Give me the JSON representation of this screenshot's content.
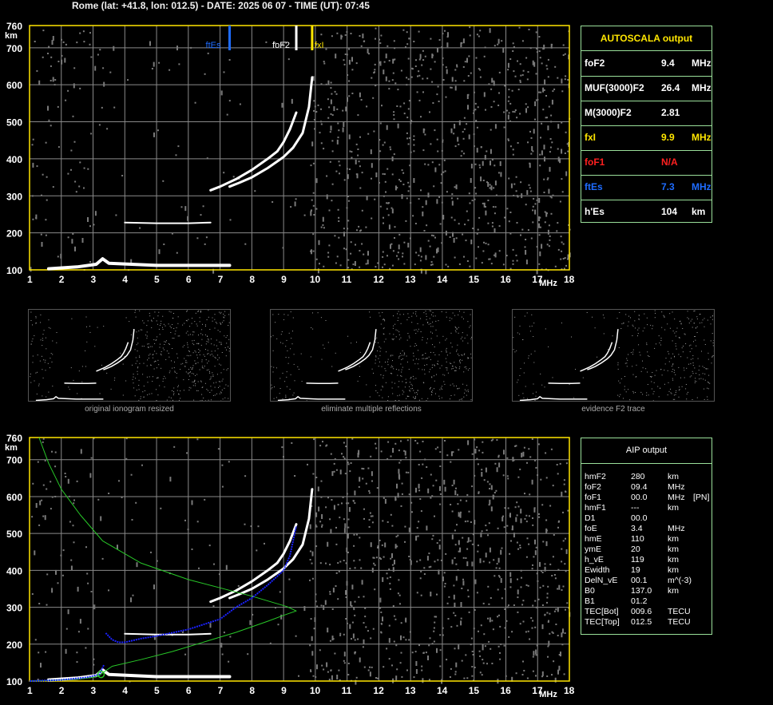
{
  "header": {
    "title": "Rome (lat: +41.8, lon: 012.5) - DATE: 2025 06 07 - TIME (UT): 07:45"
  },
  "colors": {
    "frame": "#ffe600",
    "grid": "#8a8a8a",
    "box": "#9adf9a",
    "blue": "#1e6cff",
    "red": "#ff2020",
    "green": "#28c828",
    "trace": "#1a22ff"
  },
  "autoscala": {
    "title": "AUTOSCALA output",
    "rows": [
      {
        "key": "foF2",
        "value": "9.4",
        "unit": "MHz",
        "color": "#ffffff"
      },
      {
        "key": "MUF(3000)F2",
        "value": "26.4",
        "unit": "MHz",
        "color": "#ffffff"
      },
      {
        "key": "M(3000)F2",
        "value": "2.81",
        "unit": "",
        "color": "#ffffff"
      },
      {
        "key": "fxI",
        "value": "9.9",
        "unit": "MHz",
        "color": "#ffe600"
      },
      {
        "key": "foF1",
        "value": "N/A",
        "unit": "",
        "color": "#ff2020"
      },
      {
        "key": "ftEs",
        "value": "7.3",
        "unit": "MHz",
        "color": "#1e6cff"
      },
      {
        "key": "h'Es",
        "value": "104",
        "unit": "km",
        "color": "#ffffff"
      }
    ]
  },
  "aip": {
    "title": "AIP output",
    "rows": [
      {
        "key": "hmF2",
        "value": "280",
        "unit": "km",
        "extra": ""
      },
      {
        "key": "foF2",
        "value": "09.4",
        "unit": "MHz",
        "extra": ""
      },
      {
        "key": "foF1",
        "value": "00.0",
        "unit": "MHz",
        "extra": "[PN]"
      },
      {
        "key": "hmF1",
        "value": "---",
        "unit": "km",
        "extra": ""
      },
      {
        "key": "D1",
        "value": "00.0",
        "unit": "",
        "extra": ""
      },
      {
        "key": "foE",
        "value": "3.4",
        "unit": "MHz",
        "extra": ""
      },
      {
        "key": "hmE",
        "value": "110",
        "unit": "km",
        "extra": ""
      },
      {
        "key": "ymE",
        "value": "20",
        "unit": "km",
        "extra": ""
      },
      {
        "key": "h_vE",
        "value": "119",
        "unit": "km",
        "extra": ""
      },
      {
        "key": "Ewidth",
        "value": "19",
        "unit": "km",
        "extra": ""
      },
      {
        "key": "DelN_vE",
        "value": "00.1",
        "unit": "m^(-3)",
        "extra": ""
      },
      {
        "key": "B0",
        "value": "137.0",
        "unit": "km",
        "extra": ""
      },
      {
        "key": "B1",
        "value": "01.2",
        "unit": "",
        "extra": ""
      },
      {
        "key": "TEC[Bot]",
        "value": "009.6",
        "unit": "TECU",
        "extra": ""
      },
      {
        "key": "TEC[Top]",
        "value": "012.5",
        "unit": "TECU",
        "extra": ""
      }
    ]
  },
  "thumbnails": [
    {
      "caption": "original ionogram resized"
    },
    {
      "caption": "eliminate multiple reflections"
    },
    {
      "caption": "evidence F2 trace"
    }
  ],
  "chart_data": [
    {
      "type": "scatter",
      "title": "",
      "xlabel": "MHz",
      "ylabel": "km",
      "xlim": [
        1,
        18
      ],
      "ylim": [
        100,
        760
      ],
      "xticks": [
        "1",
        "2",
        "3",
        "4",
        "5",
        "6",
        "7",
        "8",
        "9",
        "10",
        "11",
        "12",
        "13",
        "14",
        "15",
        "16",
        "17",
        "18"
      ],
      "yticks": [
        "100",
        "200",
        "300",
        "400",
        "500",
        "600",
        "700",
        "760"
      ],
      "markers": [
        {
          "label": "ftEs",
          "x": 7.3,
          "color": "#1e6cff"
        },
        {
          "label": "foF2",
          "x": 9.4,
          "color": "#ffffff"
        },
        {
          "label": "fxI",
          "x": 9.9,
          "color": "#ffe600"
        }
      ],
      "series": [
        {
          "kind": "o-trace",
          "x": [
            6.7,
            7.0,
            7.5,
            8.0,
            8.5,
            8.8,
            9.0,
            9.2,
            9.4
          ],
          "y": [
            315,
            325,
            345,
            370,
            400,
            420,
            445,
            480,
            525
          ]
        },
        {
          "kind": "x-trace",
          "x": [
            7.3,
            7.6,
            8.0,
            8.5,
            9.0,
            9.3,
            9.6,
            9.8,
            9.9
          ],
          "y": [
            325,
            335,
            350,
            375,
            405,
            430,
            470,
            540,
            620
          ]
        },
        {
          "kind": "E/Es trace",
          "x": [
            1.6,
            2.5,
            3.1,
            3.3,
            3.5,
            5.0,
            7.3
          ],
          "y": [
            103,
            108,
            115,
            130,
            118,
            112,
            112
          ]
        },
        {
          "kind": "multiple",
          "x": [
            4.0,
            5.0,
            6.0,
            6.7
          ],
          "y": [
            228,
            226,
            226,
            228
          ]
        }
      ]
    },
    {
      "type": "line",
      "title": "",
      "xlabel": "MHz",
      "ylabel": "km",
      "xlim": [
        1,
        18
      ],
      "ylim": [
        100,
        760
      ],
      "xticks": [
        "1",
        "2",
        "3",
        "4",
        "5",
        "6",
        "7",
        "8",
        "9",
        "10",
        "11",
        "12",
        "13",
        "14",
        "15",
        "16",
        "17",
        "18"
      ],
      "yticks": [
        "100",
        "200",
        "300",
        "400",
        "500",
        "600",
        "700",
        "760"
      ],
      "series": [
        {
          "name": "",
          "kind": "profile",
          "x": [
            1.0,
            2.0,
            2.6,
            3.0,
            3.2,
            3.3,
            3.6,
            4.5,
            5.5,
            6.5,
            7.5,
            8.5,
            9.0,
            9.4,
            9.1,
            8.0,
            6.0,
            4.5,
            3.3,
            2.6,
            2.0,
            1.6,
            1.3
          ],
          "y": [
            100,
            103,
            106,
            110,
            115,
            122,
            140,
            158,
            180,
            206,
            232,
            262,
            278,
            290,
            302,
            330,
            375,
            420,
            480,
            550,
            620,
            690,
            760
          ]
        },
        {
          "name": "",
          "kind": "virtual-height",
          "x": [
            3.4,
            3.6,
            3.8,
            4.0,
            4.5,
            5.0,
            6.0,
            7.0,
            7.5,
            8.0,
            8.5,
            9.0,
            9.2,
            9.4
          ],
          "y": [
            230,
            212,
            205,
            205,
            215,
            222,
            240,
            268,
            300,
            325,
            360,
            400,
            440,
            520
          ]
        },
        {
          "name": "",
          "kind": "E-curve",
          "x": [
            1.0,
            2.0,
            2.8,
            3.2,
            3.35
          ],
          "y": [
            100,
            103,
            110,
            118,
            145
          ]
        }
      ]
    }
  ]
}
